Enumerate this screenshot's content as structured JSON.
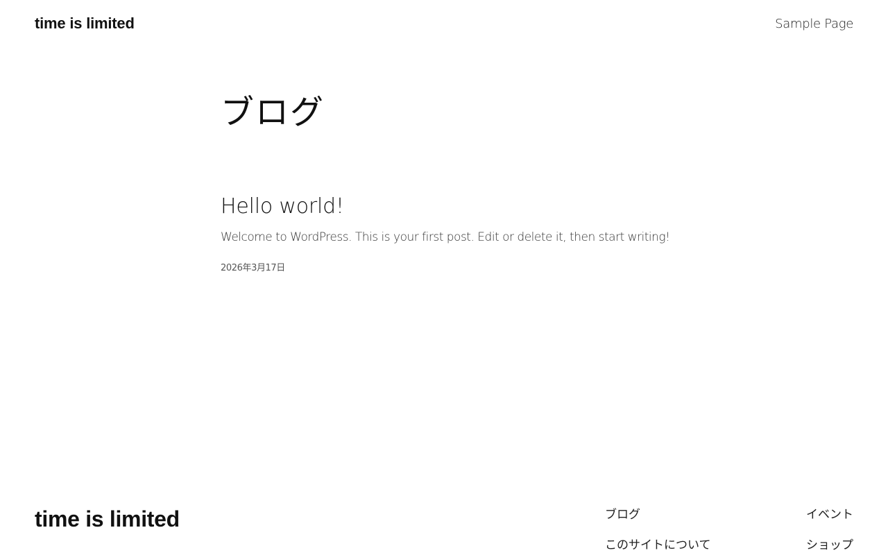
{
  "header": {
    "site_title": "time is limited",
    "nav": {
      "sample_page": "Sample Page"
    }
  },
  "main": {
    "page_heading": "ブログ",
    "posts": [
      {
        "title": "Hello world!",
        "excerpt": "Welcome to WordPress. This is your first post. Edit or delete it, then start writing!",
        "date": "2026年3月17日"
      }
    ]
  },
  "footer": {
    "site_title": "time is limited",
    "links": {
      "blog": "ブログ",
      "events": "イベント",
      "about": "このサイトについて",
      "shop": "ショップ"
    }
  }
}
